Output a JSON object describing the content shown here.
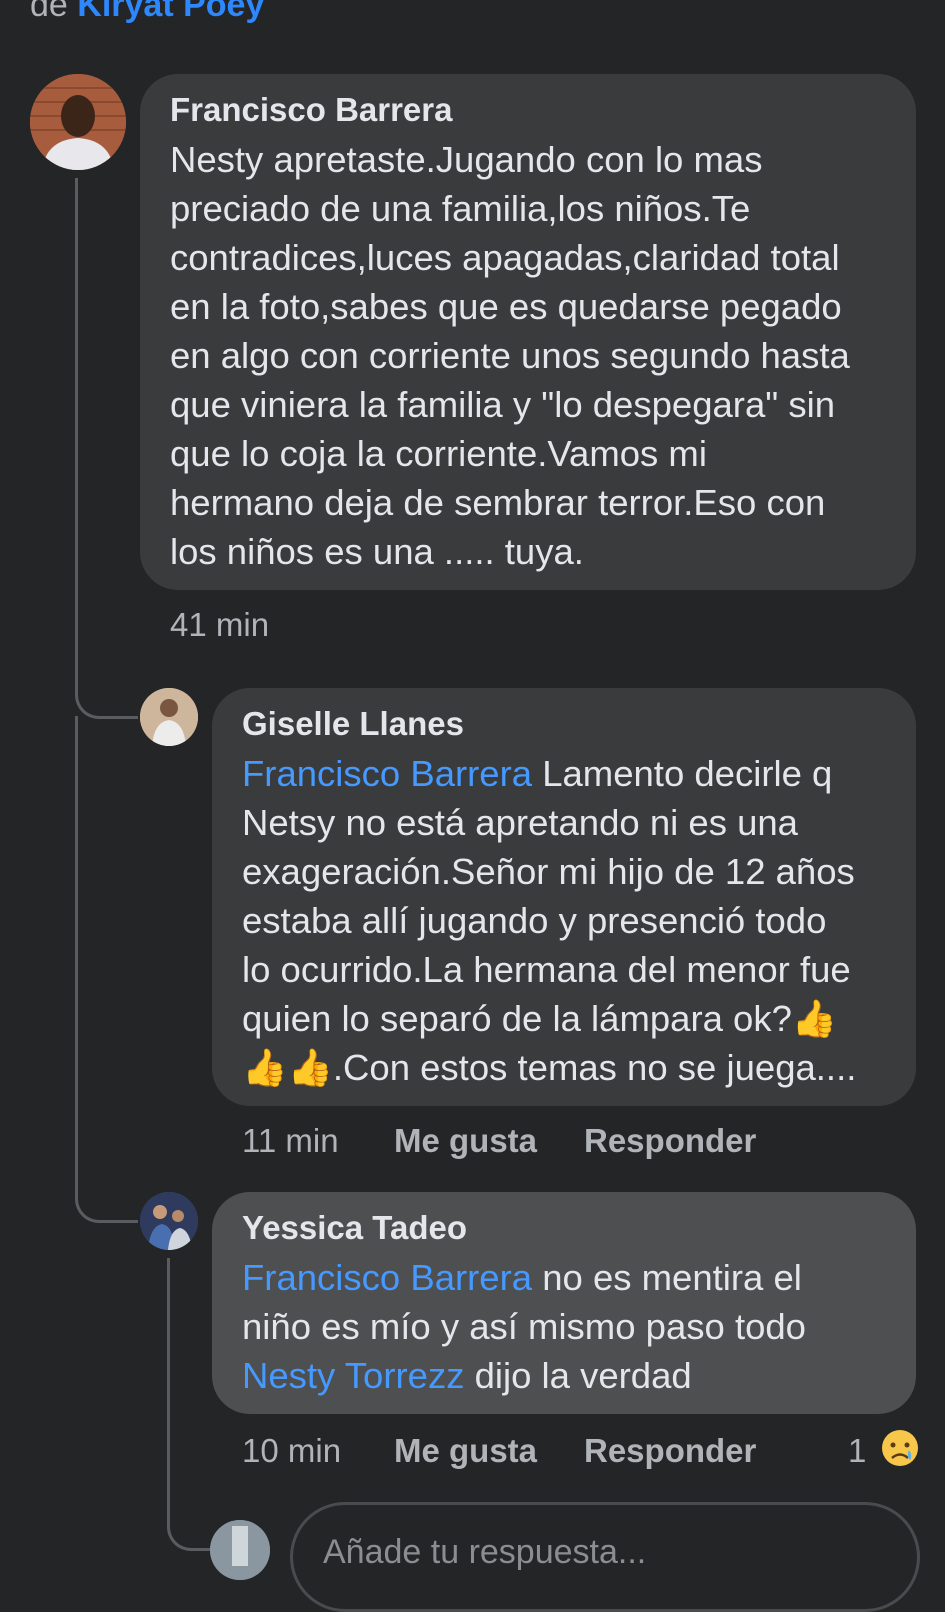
{
  "header": {
    "prefix": "de",
    "group_name": "Kiryat Poey"
  },
  "comments": [
    {
      "author": "Francisco Barrera",
      "text": "Nesty apretaste.Jugando con lo mas\npreciado de una familia,los niños.Te\ncontradices,luces apagadas,claridad total\nen la foto,sabes que es quedarse pegado\nen algo con corriente unos segundo hasta\nque viniera la familia y \"lo despegara\" sin\nque lo coja la corriente.Vamos mi\nhermano deja de sembrar terror.Eso con\nlos niños es una ..... tuya.",
      "time": "41 min"
    },
    {
      "author": "Giselle Llanes",
      "mention": "Francisco Barrera",
      "text_line1": " Lamento decirle q",
      "text_rest": "Netsy no está apretando ni es una\nexageración.Señor mi hijo de 12 años\nestaba allí jugando y presenció todo\nlo ocurrido.La hermana del menor fue\nquien lo separó de la lámpara ok?👍\n👍👍.Con estos temas no se juega....",
      "time": "11 min",
      "like_label": "Me gusta",
      "reply_label": "Responder"
    },
    {
      "author": "Yessica Tadeo",
      "mention1": "Francisco Barrera",
      "text1": " no es mentira el\nniño es mío y así mismo paso todo\n",
      "mention2": "Nesty Torrezz",
      "text2": "  dijo la verdad",
      "time": "10 min",
      "like_label": "Me gusta",
      "reply_label": "Responder",
      "reaction_count": "1",
      "reaction_icon": "sad-face"
    }
  ],
  "reply_box": {
    "placeholder": "Añade tu respuesta..."
  },
  "colors": {
    "background": "#242526",
    "bubble": "#3a3b3c",
    "bubble_highlight": "#4e4f50",
    "mention": "#4599ff",
    "link": "#2d88ff"
  }
}
